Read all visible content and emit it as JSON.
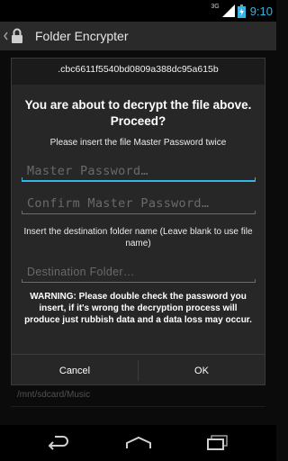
{
  "status_bar": {
    "network": "3G",
    "time": "9:10"
  },
  "action_bar": {
    "title": "Folder Encrypter"
  },
  "dialog": {
    "file_hash": ".cbc6611f5540bd0809a388dc95a615b",
    "title": "You are about to decrypt the file above. Proceed?",
    "subtitle": "Please insert the file Master Password twice",
    "master_password": {
      "placeholder": "Master Password…",
      "value": ""
    },
    "confirm_password": {
      "placeholder": "Confirm Master Password…",
      "value": ""
    },
    "destination_note": "Insert the destination folder name (Leave blank to use file name)",
    "destination_folder": {
      "placeholder": "Destination Folder…",
      "value": ""
    },
    "warning": "WARNING: Please double check the password you insert, if it's wrong the decryption process will produce just rubbish data and a data loss may occur.",
    "cancel_label": "Cancel",
    "ok_label": "OK"
  },
  "background": {
    "path": "/mnt/sdcard/Music"
  },
  "colors": {
    "accent": "#33b5e5",
    "dialog_bg": "#272727",
    "action_bar_bg": "#2a2a2a"
  },
  "icons": [
    "signal-icon",
    "battery-icon",
    "lock-icon",
    "back-icon",
    "home-icon",
    "recent-apps-icon"
  ]
}
